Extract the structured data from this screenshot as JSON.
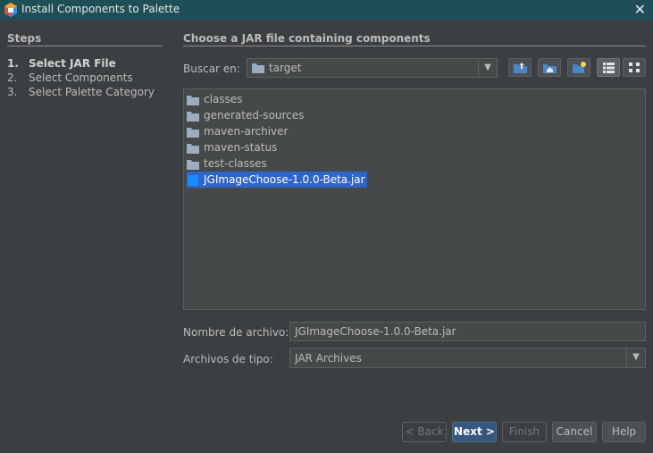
{
  "window": {
    "title": "Install Components to Palette",
    "close_glyph": "✕"
  },
  "steps": {
    "heading": "Steps",
    "items": [
      {
        "num": "1.",
        "label": "Select JAR File",
        "active": true
      },
      {
        "num": "2.",
        "label": "Select Components",
        "active": false
      },
      {
        "num": "3.",
        "label": "Select Palette Category",
        "active": false
      }
    ]
  },
  "main": {
    "heading": "Choose a JAR file containing components",
    "lookin": {
      "label": "Buscar en:",
      "value": "target"
    },
    "toolbar_icons": [
      "up-folder-icon",
      "home-icon",
      "new-folder-icon",
      "list-view-icon",
      "details-view-icon"
    ],
    "files": [
      {
        "name": "classes",
        "type": "folder"
      },
      {
        "name": "generated-sources",
        "type": "folder"
      },
      {
        "name": "maven-archiver",
        "type": "folder"
      },
      {
        "name": "maven-status",
        "type": "folder"
      },
      {
        "name": "test-classes",
        "type": "folder"
      },
      {
        "name": "JGImageChoose-1.0.0-Beta.jar",
        "type": "jar",
        "selected": true
      }
    ],
    "filename": {
      "label": "Nombre de archivo:",
      "value": "JGImageChoose-1.0.0-Beta.jar"
    },
    "filetype": {
      "label": "Archivos de tipo:",
      "value": "JAR Archives"
    }
  },
  "buttons": {
    "back": "< Back",
    "next": "Next >",
    "finish": "Finish",
    "cancel": "Cancel",
    "help": "Help"
  },
  "colors": {
    "title_bar": "#1e4f57",
    "background": "#3c3f41",
    "selection": "#2f65ca",
    "default_button": "#365880"
  }
}
